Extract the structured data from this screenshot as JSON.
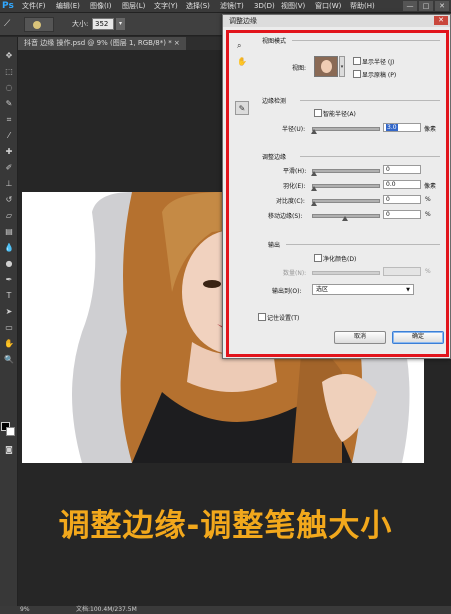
{
  "app": {
    "logo": "Ps"
  },
  "menu": [
    "文件(F)",
    "编辑(E)",
    "图像(I)",
    "图层(L)",
    "文字(Y)",
    "选择(S)",
    "滤镜(T)",
    "3D(D)",
    "视图(V)",
    "窗口(W)",
    "帮助(H)"
  ],
  "window_controls": [
    "—",
    "□",
    "✕"
  ],
  "options": {
    "size_label": "大小:",
    "size_value": "352",
    "size_arrow": "▾"
  },
  "document": {
    "tab_label": "抖音 边缘 操作.psd @ 9% (图层 1, RGB/8*) *  ×"
  },
  "status": {
    "zoom": "9%",
    "doc_info": "文档:100.4M/237.5M"
  },
  "caption": "调整边缘-调整笔触大小",
  "colors": {
    "accent_caption": "#f2a81c",
    "highlight_frame": "#e2141c"
  },
  "dialog": {
    "title": "调整边缘",
    "close": "✕",
    "view_mode": {
      "header": "视图模式",
      "view_label": "视图:",
      "show_radius": "显示半径 (J)",
      "show_original": "显示原稿 (P)"
    },
    "edge_detection": {
      "header": "边缘检测",
      "smart_radius": "智能半径(A)",
      "radius_label": "半径(U):",
      "radius_value": "3.0",
      "radius_unit": "像素"
    },
    "adjust_edge": {
      "header": "调整边缘",
      "smooth_label": "平滑(H):",
      "smooth_value": "0",
      "feather_label": "羽化(E):",
      "feather_value": "0.0",
      "feather_unit": "像素",
      "contrast_label": "对比度(C):",
      "contrast_value": "0",
      "contrast_unit": "%",
      "shift_label": "移动边缘(S):",
      "shift_value": "0",
      "shift_unit": "%"
    },
    "output": {
      "header": "输出",
      "decontaminate": "净化颜色(D)",
      "amount_label": "数量(N):",
      "amount_unit": "%",
      "output_to_label": "输出到(O):",
      "output_to_value": "选区"
    },
    "remember": "记住设置(T)",
    "cancel": "取消",
    "ok": "确定"
  }
}
